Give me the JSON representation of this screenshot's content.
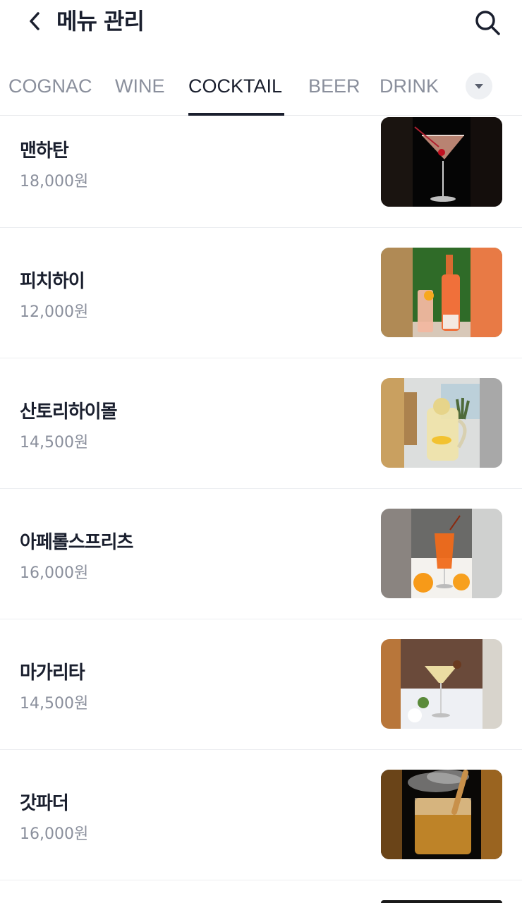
{
  "header": {
    "title": "메뉴 관리",
    "back_icon": "chevron-left-icon",
    "search_icon": "search-icon"
  },
  "tabs": [
    {
      "label": "COGNAC",
      "active": false
    },
    {
      "label": "WINE",
      "active": false
    },
    {
      "label": "COCKTAIL",
      "active": true
    },
    {
      "label": "BEER",
      "active": false
    },
    {
      "label": "DRINK",
      "active": false
    }
  ],
  "tab_more_icon": "caret-down-icon",
  "menu_items": [
    {
      "name": "맨하탄",
      "price": "18,000원"
    },
    {
      "name": "피치하이",
      "price": "12,000원"
    },
    {
      "name": "산토리하이몰",
      "price": "14,500원"
    },
    {
      "name": "아페롤스프리츠",
      "price": "16,000원"
    },
    {
      "name": "마가리타",
      "price": "14,500원"
    },
    {
      "name": "갓파더",
      "price": "16,000원"
    }
  ],
  "colors": {
    "text_primary": "#1a1f2e",
    "text_secondary": "#8a8f9c",
    "divider": "#eceef1"
  }
}
